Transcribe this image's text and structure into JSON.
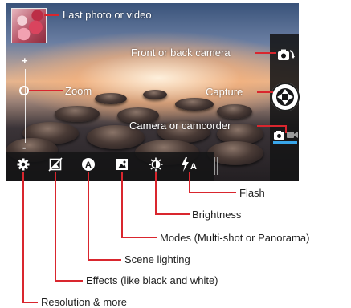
{
  "colors": {
    "callout": "#d9262e",
    "accent": "#39a6ea",
    "bar": "#161618"
  },
  "viewfinder": {
    "last_media": "Last photo or video",
    "zoom_plus": "+",
    "zoom_minus": "-"
  },
  "callouts": {
    "last_photo": "Last photo or video",
    "front_back": "Front or back camera",
    "zoom": "Zoom",
    "capture": "Capture",
    "camera_camcorder": "Camera or camcorder",
    "flash": "Flash",
    "brightness": "Brightness",
    "modes": "Modes (Multi-shot or Panorama)",
    "scene_lighting": "Scene lighting",
    "effects": "Effects (like black and white)",
    "resolution": "Resolution & more"
  },
  "icons": {
    "settings": "gear-icon",
    "effects": "effects-icon",
    "scene": "auto-scene-icon",
    "modes": "panorama-icon",
    "brightness": "brightness-icon",
    "flash": "flash-auto-icon",
    "switch_camera": "switch-camera-icon",
    "capture": "shutter-icon",
    "camera_mode": "camera-icon",
    "video_mode": "camcorder-icon"
  }
}
